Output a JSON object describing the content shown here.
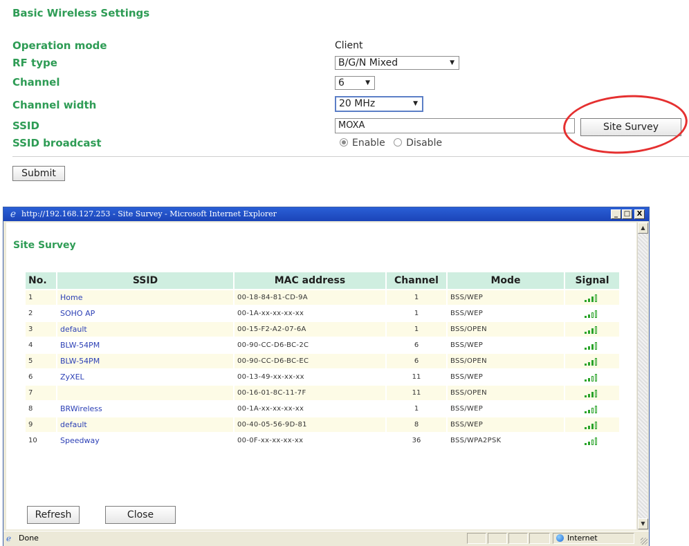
{
  "settings": {
    "title": "Basic Wireless Settings",
    "operation_mode": {
      "label": "Operation mode",
      "value": "Client"
    },
    "rf_type": {
      "label": "RF type",
      "value": "B/G/N Mixed"
    },
    "channel": {
      "label": "Channel",
      "value": "6"
    },
    "channel_width": {
      "label": "Channel width",
      "value": "20 MHz"
    },
    "ssid": {
      "label": "SSID",
      "value": "MOXA"
    },
    "ssid_broadcast": {
      "label": "SSID broadcast",
      "enable": "Enable",
      "disable": "Disable",
      "selected": "Enable"
    },
    "site_survey_button": "Site Survey",
    "submit_button": "Submit"
  },
  "popup": {
    "window_title": "http://192.168.127.253 - Site Survey - Microsoft Internet Explorer",
    "title_buttons": {
      "minimize": "_",
      "maximize": "□",
      "close": "X"
    },
    "heading": "Site Survey",
    "columns": {
      "no": "No.",
      "ssid": "SSID",
      "mac": "MAC address",
      "channel": "Channel",
      "mode": "Mode",
      "signal": "Signal"
    },
    "rows": [
      {
        "no": "1",
        "ssid": "Home",
        "mac": "00-18-84-81-CD-9A",
        "channel": "1",
        "mode": "BSS/WEP",
        "signal_bars": 3
      },
      {
        "no": "2",
        "ssid": "SOHO AP",
        "mac": "00-1A-xx-xx-xx-xx",
        "channel": "1",
        "mode": "BSS/WEP",
        "signal_bars": 2
      },
      {
        "no": "3",
        "ssid": "default",
        "mac": "00-15-F2-A2-07-6A",
        "channel": "1",
        "mode": "BSS/OPEN",
        "signal_bars": 3
      },
      {
        "no": "4",
        "ssid": "BLW-54PM",
        "mac": "00-90-CC-D6-BC-2C",
        "channel": "6",
        "mode": "BSS/WEP",
        "signal_bars": 3
      },
      {
        "no": "5",
        "ssid": "BLW-54PM",
        "mac": "00-90-CC-D6-BC-EC",
        "channel": "6",
        "mode": "BSS/OPEN",
        "signal_bars": 3
      },
      {
        "no": "6",
        "ssid": "ZyXEL",
        "mac": "00-13-49-xx-xx-xx",
        "channel": "11",
        "mode": "BSS/WEP",
        "signal_bars": 2
      },
      {
        "no": "7",
        "ssid": "",
        "mac": "00-16-01-8C-11-7F",
        "channel": "11",
        "mode": "BSS/OPEN",
        "signal_bars": 3
      },
      {
        "no": "8",
        "ssid": "BRWireless",
        "mac": "00-1A-xx-xx-xx-xx",
        "channel": "1",
        "mode": "BSS/WEP",
        "signal_bars": 2
      },
      {
        "no": "9",
        "ssid": "default",
        "mac": "00-40-05-56-9D-81",
        "channel": "8",
        "mode": "BSS/WEP",
        "signal_bars": 3
      },
      {
        "no": "10",
        "ssid": "Speedway",
        "mac": "00-0F-xx-xx-xx-xx",
        "channel": "36",
        "mode": "BSS/WPA2PSK",
        "signal_bars": 2
      }
    ],
    "refresh_button": "Refresh",
    "close_button": "Close",
    "status": {
      "text": "Done",
      "zone": "Internet"
    }
  },
  "colors": {
    "label_green": "#2e9c55",
    "header_bg": "#cfeee0",
    "annotation_red": "#e53030",
    "link_blue": "#2b3fb5",
    "signal_green": "#29a329"
  }
}
